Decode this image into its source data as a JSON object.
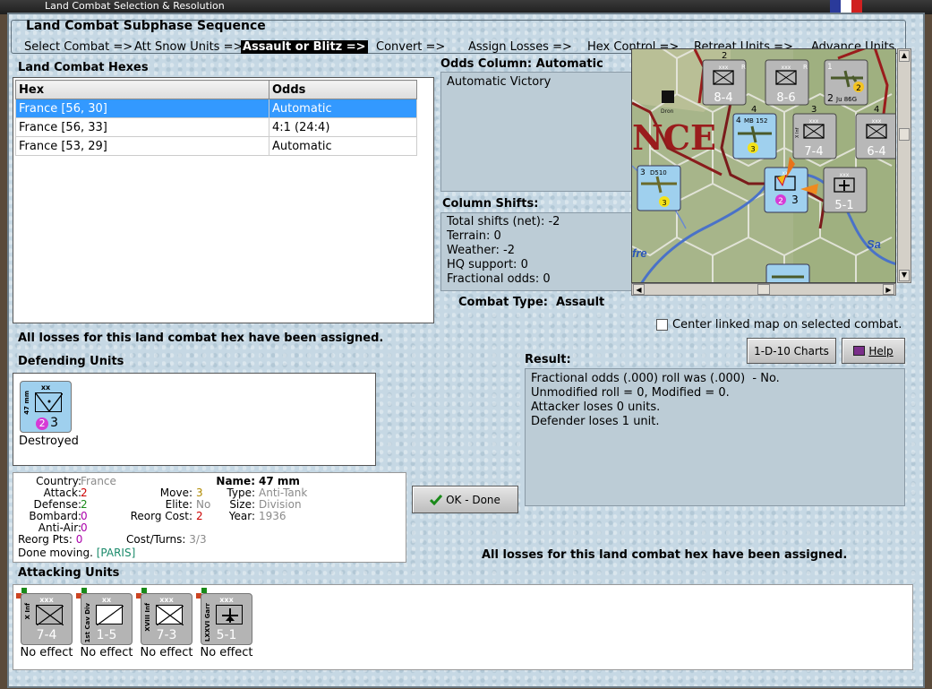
{
  "window": {
    "title": "Land Combat Selection & Resolution"
  },
  "sequence": {
    "title": "Land Combat Subphase Sequence",
    "steps": [
      "Select Combat =>",
      "Att Snow Units =>",
      "Assault or Blitz =>",
      "Convert =>",
      "Assign Losses =>",
      "Hex Control =>",
      "Retreat Units =>",
      "Advance Units"
    ],
    "active_index": 2
  },
  "hexes": {
    "title": "Land Combat Hexes",
    "columns": [
      "Hex",
      "Odds"
    ],
    "rows": [
      {
        "hex": "France [56, 30]",
        "odds": "Automatic",
        "selected": true
      },
      {
        "hex": "France [56, 33]",
        "odds": "4:1 (24:4)",
        "selected": false
      },
      {
        "hex": "France [53, 29]",
        "odds": "Automatic",
        "selected": false
      }
    ]
  },
  "odds": {
    "title": "Odds Column: Automatic",
    "value": "Automatic Victory"
  },
  "shifts": {
    "title": "Column Shifts:",
    "lines": [
      "Total shifts (net): -2",
      "Terrain: 0",
      "Weather: -2",
      "HQ support: 0",
      "Fractional odds: 0"
    ]
  },
  "combat_type": "Combat Type:  Assault",
  "center_map_label": "Center linked map on selected combat.",
  "charts_button": "1-D-10 Charts",
  "help_button": "Help",
  "losses_msg": "All losses for this land combat hex have been assigned.",
  "defending": {
    "title": "Defending Units",
    "units": [
      {
        "size": "xx",
        "name_vertical": "47 mm",
        "stats": "3",
        "badge": "2",
        "status": "Destroyed"
      }
    ]
  },
  "unit_info": {
    "country_label": "Country:",
    "country": "France",
    "attack_label": "Attack:",
    "attack": "2",
    "defense_label": "Defense:",
    "defense": "2",
    "bombard_label": "Bombard:",
    "bombard": "0",
    "antiair_label": "Anti-Air:",
    "antiair": "0",
    "reorg_label": "Reorg Pts:",
    "reorg": "0",
    "move_label": "Move:",
    "move": "3",
    "elite_label": "Elite:",
    "elite": "No",
    "reorg_cost_label": "Reorg Cost:",
    "reorg_cost": "2",
    "cost_turns_label": "Cost/Turns:",
    "cost_turns": "3/3",
    "name_label": "Name:",
    "name": "47 mm",
    "type_label": "Type:",
    "type": "Anti-Tank",
    "size_label": "Size:",
    "size": "Division",
    "year_label": "Year:",
    "year": "1936",
    "done_label": "Done moving.",
    "location": "[PARIS]"
  },
  "ok_button": "OK - Done",
  "result": {
    "title": "Result:",
    "lines": [
      "Fractional odds (.000) roll was (.000)  - No.",
      "Unmodified roll = 0, Modified = 0.",
      "Attacker loses 0 units.",
      "Defender loses 1 unit."
    ]
  },
  "attacking": {
    "title": "Attacking Units",
    "units": [
      {
        "size": "xxx",
        "name_vertical": "X Inf",
        "stats": "7-4",
        "status": "No effect"
      },
      {
        "size": "xx",
        "name_vertical": "1st Cav Div",
        "stats": "1-5",
        "status": "No effect"
      },
      {
        "size": "xxx",
        "name_vertical": "XVIII Inf",
        "stats": "7-3",
        "status": "No effect"
      },
      {
        "size": "xxx",
        "name_vertical": "LXXVI Garr",
        "stats": "5-1",
        "status": "No effect"
      }
    ]
  },
  "map": {
    "region_label": "NCE",
    "labels": [
      "Sa",
      "fre",
      "Dron"
    ],
    "counters": [
      {
        "top": "xxx",
        "stats": "8-4",
        "tag": "R",
        "corner": "2"
      },
      {
        "top": "xxx",
        "stats": "8-6",
        "tag": "R",
        "corner": ""
      },
      {
        "top": "Ju 86G",
        "stats": "2",
        "tag": "1",
        "corner": "2"
      },
      {
        "top": "MB 152",
        "stats": "3",
        "tag": "4",
        "corner": "4"
      },
      {
        "top": "xxx",
        "stats": "7-4",
        "tag": "X Inf",
        "corner": "3"
      },
      {
        "top": "xxx",
        "stats": "6-4",
        "tag": "",
        "corner": "4"
      },
      {
        "top": "D510",
        "stats": "3",
        "tag": "3",
        "corner": ""
      },
      {
        "top": "xx",
        "stats": "3",
        "tag": "2",
        "corner": ""
      },
      {
        "top": "xxx",
        "stats": "5-1",
        "tag": "",
        "corner": ""
      }
    ]
  },
  "colors": {
    "panel_bg": "#c6d8e4",
    "selection": "#3399ff",
    "unit_blue": "#9fd0ee",
    "unit_grey": "#b4b4b4",
    "red_value": "#cc0000",
    "green_value": "#1a8a1a",
    "purple_value": "#aa00aa"
  }
}
